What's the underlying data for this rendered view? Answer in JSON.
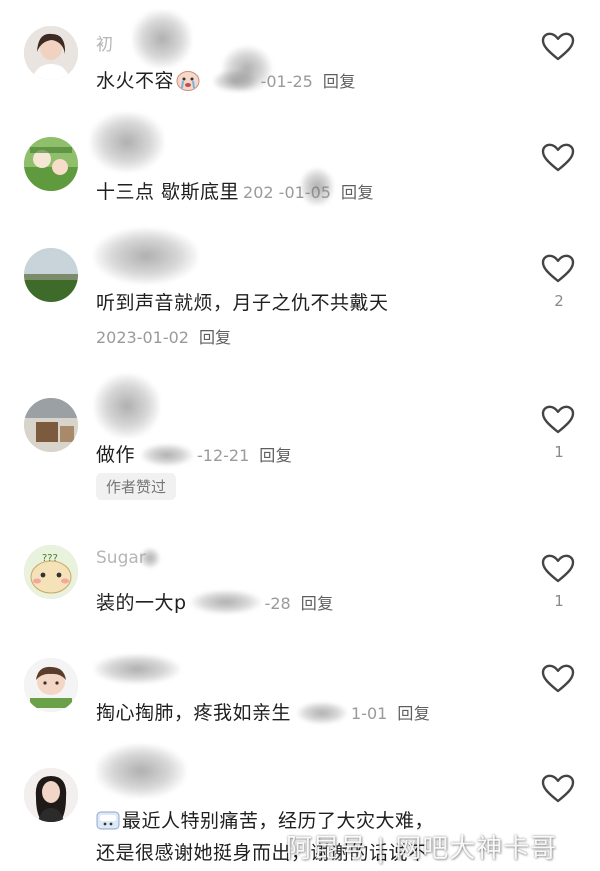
{
  "comments": [
    {
      "username": "初",
      "text": "水火不容",
      "date": "-01-25",
      "reply_label": "回复",
      "likes": ""
    },
    {
      "username": "",
      "text": "十三点 歇斯底里",
      "date": "202 -01-05",
      "reply_label": "回复",
      "likes": ""
    },
    {
      "username": "",
      "text": "听到声音就烦，月子之仇不共戴天",
      "date": "2023-01-02",
      "reply_label": "回复",
      "likes": "2"
    },
    {
      "username": "",
      "text": "做作",
      "date": "-12-21",
      "reply_label": "回复",
      "likes": "1",
      "badge": "作者赞过"
    },
    {
      "username": "Sugar",
      "text": "装的一大p",
      "date": "-28",
      "reply_label": "回复",
      "likes": "1"
    },
    {
      "username": "",
      "text": "掏心掏肺，疼我如亲生",
      "date": "1-01",
      "reply_label": "回复",
      "likes": ""
    },
    {
      "username": "",
      "text_line1": "最近人特别痛苦，经历了大灾大难，",
      "text_line2": "还是很感谢她挺身而出，谢谢的话说不",
      "likes": ""
    }
  ],
  "watermark": "阿昆号 | 网吧大神卡哥",
  "icons": {
    "like": "heart-outline-icon",
    "emoji_crying": "crying-face-emoji",
    "emoji_sticker": "sticker-emoji"
  },
  "colors": {
    "text": "#1f1f1f",
    "meta": "#9a9a9a",
    "reply": "#5e5e5e",
    "username": "#b6b6b6",
    "heart": "#444444"
  }
}
